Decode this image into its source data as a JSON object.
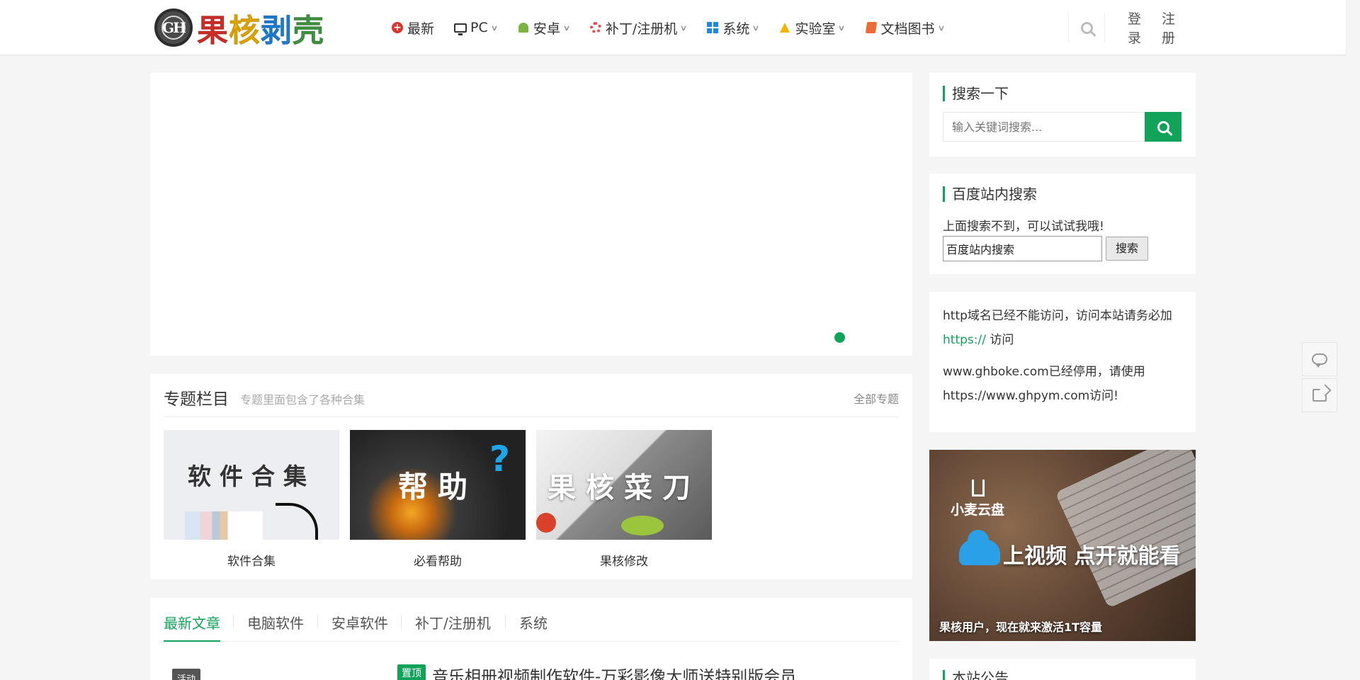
{
  "logo": {
    "mark": "GH",
    "chars": [
      "果",
      "核",
      "剥",
      "壳"
    ],
    "char_colors": [
      "#e0322a",
      "#f4b400",
      "#1e88e5",
      "#43a047"
    ]
  },
  "nav": [
    {
      "label": "最新",
      "icon": "plus-circle-icon",
      "dropdown": false
    },
    {
      "label": "PC",
      "icon": "monitor-icon",
      "dropdown": true
    },
    {
      "label": "安卓",
      "icon": "android-icon",
      "dropdown": true
    },
    {
      "label": "补丁/注册机",
      "icon": "gear-icon",
      "dropdown": true
    },
    {
      "label": "系统",
      "icon": "windows-icon",
      "dropdown": true
    },
    {
      "label": "实验室",
      "icon": "flask-icon",
      "dropdown": true
    },
    {
      "label": "文档图书",
      "icon": "book-icon",
      "dropdown": true
    }
  ],
  "header": {
    "login": "登录",
    "register": "注册"
  },
  "topics": {
    "title": "专题栏目",
    "subtitle": "专题里面包含了各种合集",
    "all_link": "全部专题",
    "items": [
      {
        "image_text": "软件合集",
        "label": "软件合集"
      },
      {
        "image_text": "帮助",
        "label": "必看帮助"
      },
      {
        "image_text": "果核菜刀",
        "label": "果核修改"
      }
    ]
  },
  "tabs": [
    "最新文章",
    "电脑软件",
    "安卓软件",
    "补丁/注册机",
    "系统"
  ],
  "post": {
    "badge": "活动",
    "pin": "置顶",
    "title": "音乐相册视频制作软件-万彩影像大师送特别版会员"
  },
  "sidebar": {
    "search": {
      "title": "搜索一下",
      "placeholder": "输入关键词搜索..."
    },
    "baidu": {
      "title": "百度站内搜索",
      "hint": "上面搜索不到，可以试试我哦!",
      "input_value": "百度站内搜索",
      "button": "搜索"
    },
    "notice": {
      "line1_pre": "http域名已经不能访问，访问本站请务必加",
      "line1_link": "https://",
      "line1_post": " 访问",
      "line2": "www.ghboke.com已经停用，请使用https://www.ghpym.com访问!"
    },
    "ad": {
      "brand": "小麦云盘",
      "headline": "上视频 点开就能看",
      "footer": "果核用户，现在就来激活1T容量"
    },
    "next_title": "本站公告"
  },
  "colors": {
    "accent": "#12a35a"
  }
}
